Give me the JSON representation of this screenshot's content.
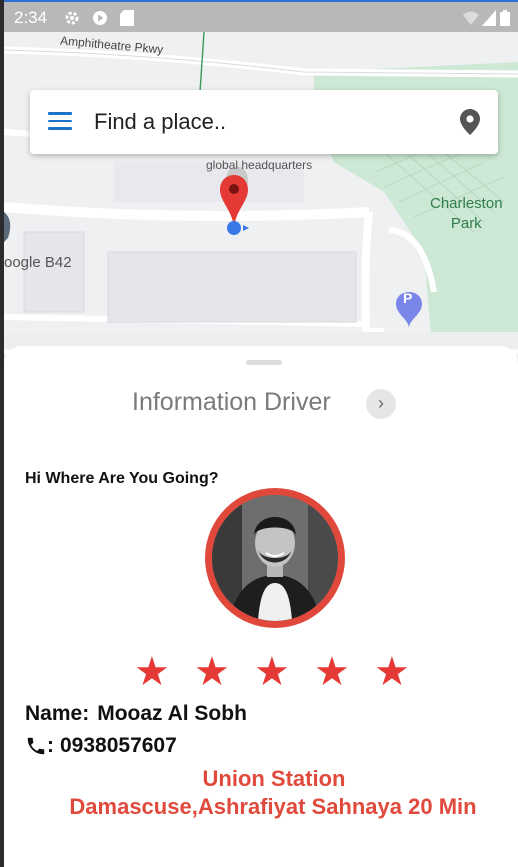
{
  "statusbar": {
    "time": "2:34"
  },
  "map": {
    "road_label": "Amphitheatre Pkwy",
    "poi_label": "global headquarters",
    "park_label_line1": "Charleston",
    "park_label_line2": "Park",
    "building_label": "oogle B42",
    "parking_glyph": "P"
  },
  "search": {
    "placeholder": "Find a place.."
  },
  "sheet": {
    "title": "Information Driver",
    "next_glyph": "›",
    "greeting": "Hi Where Are You Going?",
    "rating": 5,
    "star_glyph": "★",
    "name_label": "Name:",
    "name_value": "Mooaz Al Sobh",
    "phone_sep": ":",
    "phone_value": "0938057607",
    "destination_line1": "Union Station",
    "destination_line2": "Damascuse,Ashrafiyat Sahnaya 20 Min"
  },
  "colors": {
    "accent": "#e53935",
    "menu": "#1a73c8",
    "park": "#cde8d4",
    "location": "#3b78e7"
  },
  "icons": [
    "settings-icon",
    "play-icon",
    "sd-card-icon",
    "wifi-icon",
    "signal-icon",
    "battery-icon",
    "menu-icon",
    "map-pin-icon",
    "phone-icon",
    "star-icon",
    "parking-icon",
    "location-dot-icon"
  ]
}
